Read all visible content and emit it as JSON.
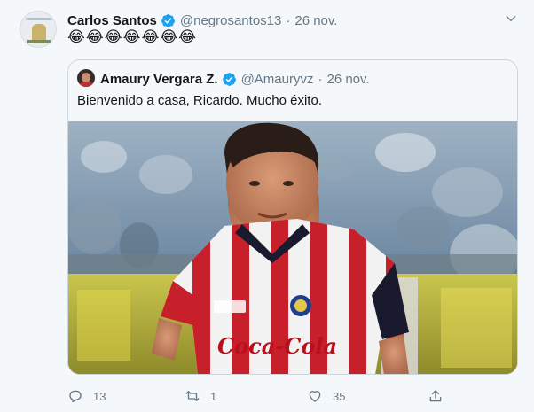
{
  "tweet": {
    "author_name": "Carlos Santos",
    "author_handle": "@negrosantos13",
    "separator": "·",
    "date": "26 nov.",
    "text": "😂😂😂😂😂😂😂"
  },
  "quote": {
    "author_name": "Amaury Vergara Z.",
    "author_handle": "@Amauryvz",
    "separator": "·",
    "date": "26 nov.",
    "text": "Bienvenido a casa, Ricardo. Mucho éxito.",
    "shirt_text": "Coca-Cola",
    "badge_text": "Pegaso"
  },
  "actions": {
    "replies": "13",
    "retweets": "1",
    "likes": "35"
  },
  "colors": {
    "verified": "#1da1f2",
    "muted": "#657786",
    "border": "#ccd6dd",
    "background": "#f5f8fa"
  },
  "icons": [
    "verified-badge-icon",
    "chevron-down-icon",
    "reply-icon",
    "retweet-icon",
    "like-icon",
    "share-icon"
  ]
}
